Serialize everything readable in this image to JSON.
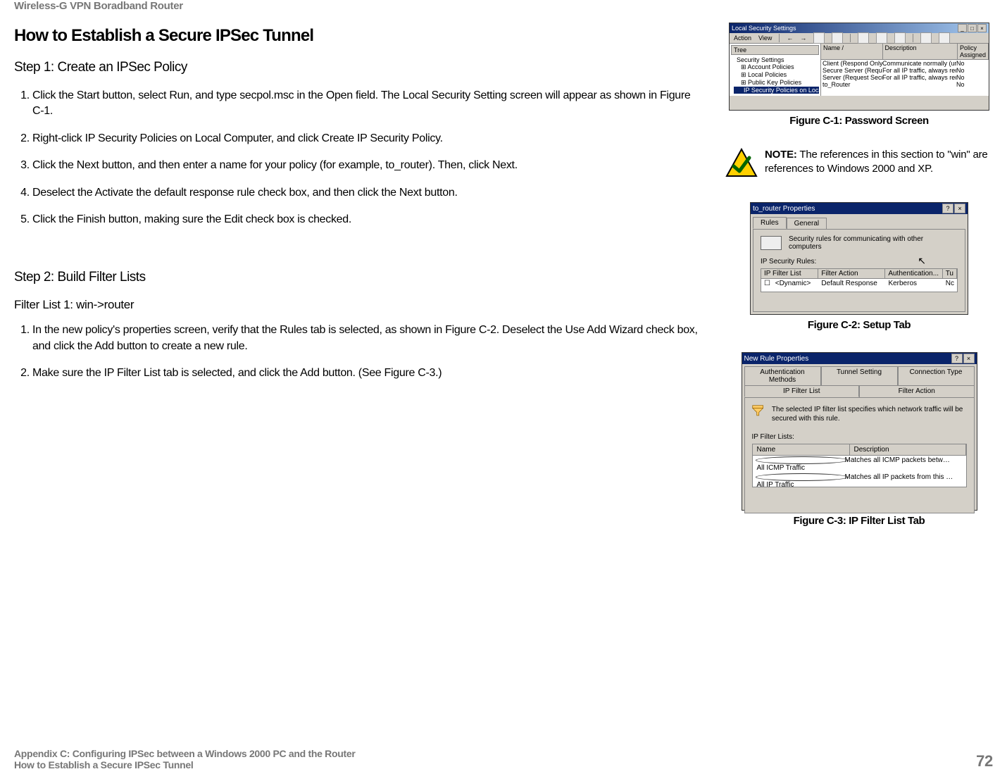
{
  "header": {
    "product": "Wireless-G VPN Boradband Router"
  },
  "section": {
    "title": "How to Establish a Secure IPSec Tunnel",
    "step1_title": "Step 1: Create an IPSec Policy",
    "step1_items": [
      "Click the Start button, select Run, and type secpol.msc in the Open field.  The Local Security Setting screen will appear as shown in Figure C-1.",
      "Right-click IP Security Policies on Local Computer, and click Create IP Security Policy.",
      "Click the Next button, and then enter a name for your policy (for example, to_router). Then, click Next.",
      "Deselect the Activate the default response rule check box, and then click the Next button.",
      "Click the Finish button, making sure the Edit check box is checked."
    ],
    "step2_title": "Step 2: Build Filter Lists",
    "step2_sub": "Filter List 1: win->router",
    "step2_items": [
      "In the new policy's properties screen, verify that the Rules tab is selected, as shown in Figure C-2. Deselect the Use Add Wizard check box, and click the Add button to create a new rule.",
      "Make sure the IP Filter List tab is selected, and click the Add button. (See Figure C-3.)"
    ]
  },
  "note": {
    "label": "NOTE:",
    "text": "The references in this section to \"win\" are references to Windows 2000 and XP."
  },
  "figc1": {
    "caption": "Figure C-1: Password Screen",
    "title": "Local Security Settings",
    "menu_action": "Action",
    "menu_view": "View",
    "tree_hdr": "Tree",
    "tree": [
      "Security Settings",
      "Account Policies",
      "Local Policies",
      "Public Key Policies",
      "IP Security Policies on Local Machine"
    ],
    "list_hdr": {
      "name": "Name  /",
      "desc": "Description",
      "pa": "Policy Assigned"
    },
    "rows": [
      {
        "n": "Client (Respond Only)",
        "d": "Communicate normally (uns…",
        "p": "No"
      },
      {
        "n": "Secure Server (Requir…",
        "d": "For all IP traffic, always req…",
        "p": "No"
      },
      {
        "n": "Server (Request Secu…",
        "d": "For all IP traffic, always req…",
        "p": "No"
      },
      {
        "n": "to_Router",
        "d": "",
        "p": "No"
      }
    ]
  },
  "figc2": {
    "caption": "Figure C-2: Setup Tab",
    "title": "to_router Properties",
    "tab_rules": "Rules",
    "tab_general": "General",
    "desc": "Security rules for communicating with other computers",
    "sub": "IP Security Rules:",
    "hdr": {
      "a": "IP Filter List",
      "b": "Filter Action",
      "c": "Authentication...",
      "d": "Tu"
    },
    "row": {
      "a": "<Dynamic>",
      "b": "Default Response",
      "c": "Kerberos",
      "d": "Nc"
    }
  },
  "figc3": {
    "caption": "Figure C-3: IP Filter List Tab",
    "title": "New Rule Properties",
    "tabs_row1": [
      "Authentication Methods",
      "Tunnel Setting",
      "Connection Type"
    ],
    "tabs_row2": [
      "IP Filter List",
      "Filter Action"
    ],
    "desc": "The selected IP filter list specifies which network traffic will be secured with this rule.",
    "sub": "IP Filter Lists:",
    "hdr": {
      "a": "Name",
      "b": "Description"
    },
    "rows": [
      {
        "a": "All ICMP Traffic",
        "b": "Matches all ICMP packets betw…"
      },
      {
        "a": "All IP Traffic",
        "b": "Matches all IP packets from this …"
      }
    ]
  },
  "footer": {
    "line1": "Appendix C: Configuring IPSec between a Windows 2000 PC and the Router",
    "line2": "How to Establish a Secure IPSec Tunnel",
    "page": "72"
  }
}
